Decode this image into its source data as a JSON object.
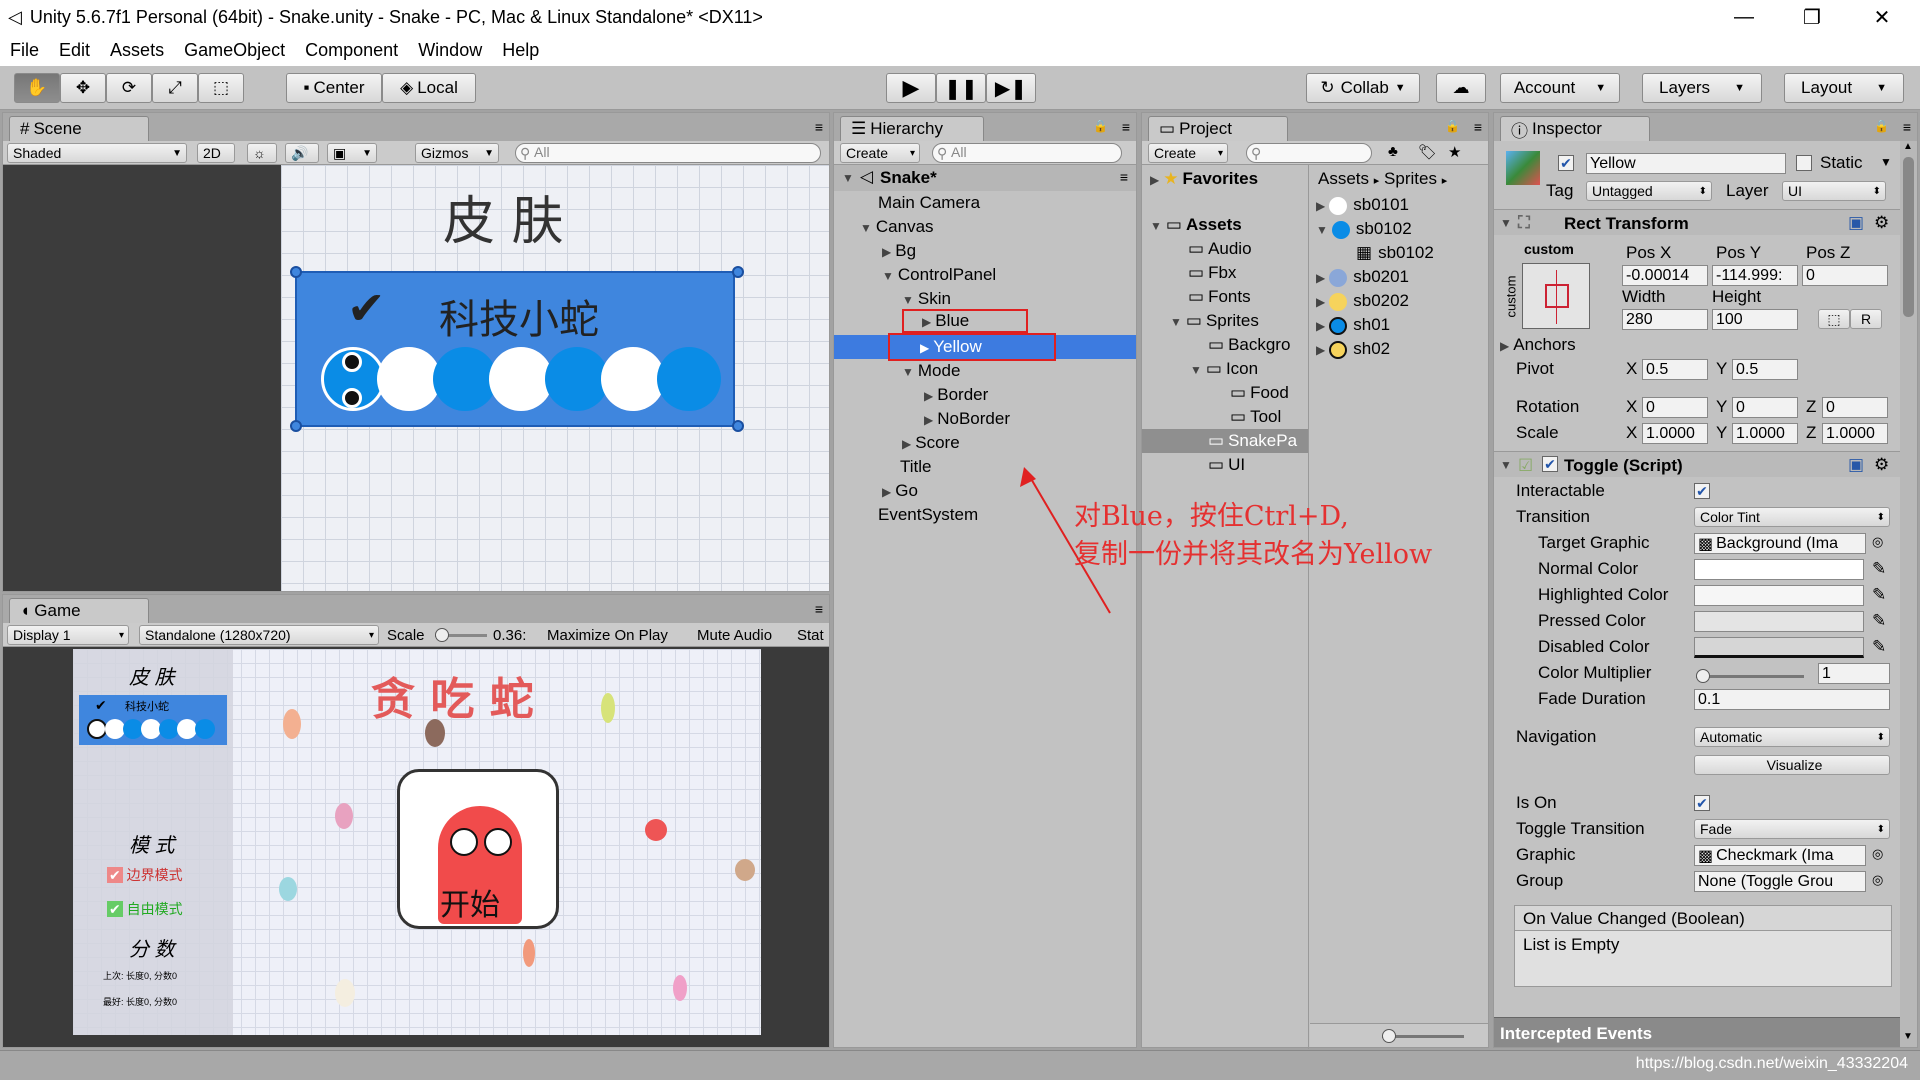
{
  "window": {
    "title": "Unity 5.6.7f1 Personal (64bit) - Snake.unity - Snake - PC, Mac & Linux Standalone* <DX11>",
    "min": "—",
    "max": "❐",
    "close": "✕"
  },
  "menu": [
    "File",
    "Edit",
    "Assets",
    "GameObject",
    "Component",
    "Window",
    "Help"
  ],
  "toolbar": {
    "center": "Center",
    "local": "Local",
    "collab": "Collab",
    "account": "Account",
    "layers": "Layers",
    "layout": "Layout"
  },
  "scene": {
    "tab": "Scene",
    "shaded": "Shaded",
    "twod": "2D",
    "gizmos": "Gizmos",
    "search": "All",
    "title": "皮 肤",
    "label": "科技小蛇"
  },
  "game": {
    "tab": "Game",
    "display": "Display 1",
    "resolution": "Standalone (1280x720)",
    "scale_label": "Scale",
    "scale_value": "0.36:",
    "maximize": "Maximize On Play",
    "mute": "Mute Audio",
    "stats": "Stat",
    "side_title": "皮 肤",
    "side_skin": "科技小蛇",
    "mode_title": "模 式",
    "mode_border": "边界模式",
    "mode_free": "自由模式",
    "score_title": "分 数",
    "score_line1": "上次: 长度0, 分数0",
    "score_line2": "最好: 长度0, 分数0",
    "game_title": "贪 吃 蛇",
    "start": "开始"
  },
  "hierarchy": {
    "tab": "Hierarchy",
    "create": "Create",
    "search": "All",
    "scene_name": "Snake*",
    "items": [
      "Main Camera",
      "Canvas",
      "Bg",
      "ControlPanel",
      "Skin",
      "Blue",
      "Yellow",
      "Mode",
      "Border",
      "NoBorder",
      "Score",
      "Title",
      "Go",
      "EventSystem"
    ]
  },
  "annotation": {
    "line1": "对Blue，按住Ctrl+D,",
    "line2": "复制一份并将其改名为Yellow"
  },
  "project": {
    "tab": "Project",
    "create": "Create",
    "favorites": "Favorites",
    "assets": "Assets",
    "folders": [
      "Audio",
      "Fbx",
      "Fonts",
      "Sprites",
      "Backgro",
      "Icon",
      "Food",
      "Tool",
      "SnakePa",
      "UI"
    ],
    "crumb1": "Assets",
    "crumb2": "Sprites",
    "sprites": [
      "sb0101",
      "sb0102",
      "sb0102",
      "sb0201",
      "sb0202",
      "sh01",
      "sh02"
    ]
  },
  "inspector": {
    "tab": "Inspector",
    "name": "Yellow",
    "static": "Static",
    "tag_label": "Tag",
    "tag": "Untagged",
    "layer_label": "Layer",
    "layer": "UI",
    "rect": {
      "title": "Rect Transform",
      "custom": "custom",
      "custom_v": "custom",
      "posx_l": "Pos X",
      "posy_l": "Pos Y",
      "posz_l": "Pos Z",
      "posx": "-0.00014",
      "posy": "-114.999:",
      "posz": "0",
      "width_l": "Width",
      "height_l": "Height",
      "width": "280",
      "height": "100",
      "r": "R",
      "anchors": "Anchors",
      "pivot": "Pivot",
      "pivot_x": "0.5",
      "pivot_y": "0.5",
      "rotation": "Rotation",
      "rot_x": "0",
      "rot_y": "0",
      "rot_z": "0",
      "scale": "Scale",
      "sc_x": "1.0000",
      "sc_y": "1.0000",
      "sc_z": "1.0000",
      "x": "X",
      "y": "Y",
      "z": "Z"
    },
    "toggle": {
      "title": "Toggle (Script)",
      "interactable": "Interactable",
      "transition": "Transition",
      "transition_v": "Color Tint",
      "target": "Target Graphic",
      "target_v": "Background (Ima",
      "normal": "Normal Color",
      "highlighted": "Highlighted Color",
      "pressed": "Pressed Color",
      "disabled": "Disabled Color",
      "multiplier": "Color Multiplier",
      "multiplier_v": "1",
      "fade": "Fade Duration",
      "fade_v": "0.1",
      "navigation": "Navigation",
      "navigation_v": "Automatic",
      "visualize": "Visualize",
      "ison": "Is On",
      "toggle_trans": "Toggle Transition",
      "toggle_trans_v": "Fade",
      "graphic": "Graphic",
      "graphic_v": "Checkmark (Ima",
      "group": "Group",
      "group_v": "None (Toggle Grou",
      "event": "On Value Changed (Boolean)",
      "empty": "List is Empty"
    },
    "intercepted": "Intercepted Events"
  },
  "watermark": "https://blog.csdn.net/weixin_43332204"
}
